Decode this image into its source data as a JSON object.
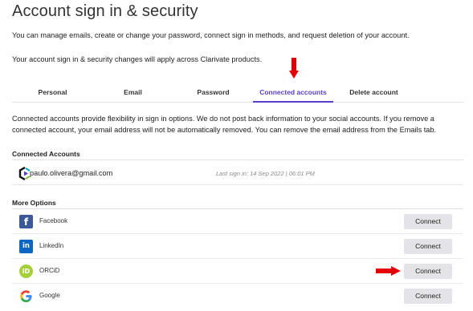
{
  "page": {
    "title": "Account sign in & security",
    "description": "You can manage emails, create or change your password, connect sign in methods, and request deletion of your account.",
    "scope_note": "Your account sign in & security changes will apply across Clarivate products."
  },
  "tabs": [
    {
      "label": "Personal",
      "active": false
    },
    {
      "label": "Email",
      "active": false
    },
    {
      "label": "Password",
      "active": false
    },
    {
      "label": "Connected accounts",
      "active": true
    },
    {
      "label": "Delete account",
      "active": false
    }
  ],
  "connected": {
    "info": "Connected accounts provide flexibility in sign in options. We do not post back information to your social accounts. If you remove a connected account, your email address will not be automatically removed. You can remove the email address from the Emails tab.",
    "section_label": "Connected Accounts",
    "account": {
      "email": "paulo.olivera@gmail.com",
      "last_sign_in": "Last sign in: 14 Sep 2022 | 06:01 PM",
      "icon": "clarivate-logo-icon"
    }
  },
  "more_options": {
    "section_label": "More Options",
    "connect_label": "Connect",
    "items": [
      {
        "label": "Facebook",
        "icon": "facebook-icon",
        "icon_glyph": "f"
      },
      {
        "label": "LinkedIn",
        "icon": "linkedin-icon",
        "icon_glyph": "in"
      },
      {
        "label": "ORCiD",
        "icon": "orcid-icon",
        "icon_glyph": "iD"
      },
      {
        "label": "Google",
        "icon": "google-icon",
        "icon_glyph": "G"
      }
    ]
  },
  "colors": {
    "accent": "#5b3fc7",
    "annotation_arrow": "#e30000",
    "button_bg": "#e4e4e8"
  }
}
